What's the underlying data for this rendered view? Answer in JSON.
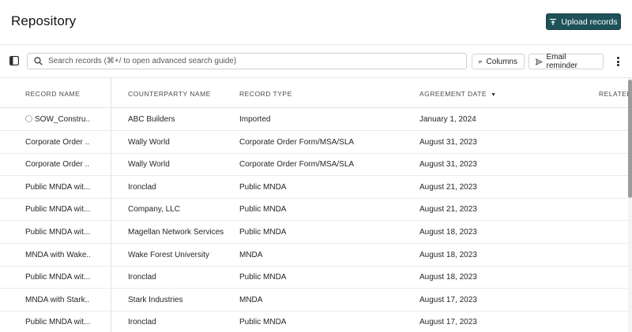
{
  "header": {
    "title": "Repository",
    "upload_label": "Upload records"
  },
  "toolbar": {
    "search_placeholder": "Search records (⌘+/ to open advanced search guide)",
    "columns_label": "Columns",
    "email_label": "Email reminder"
  },
  "table": {
    "columns": [
      "RECORD NAME",
      "COUNTERPARTY NAME",
      "RECORD TYPE",
      "AGREEMENT DATE",
      "RELATED"
    ],
    "sorted_column": "AGREEMENT DATE",
    "rows": [
      {
        "name": "SOW_Constru...",
        "counterparty": "ABC Builders",
        "type": "Imported",
        "date": "January 1, 2024",
        "loading": true
      },
      {
        "name": "Corporate Order ...",
        "counterparty": "Wally World",
        "type": "Corporate Order Form/MSA/SLA",
        "date": "August 31, 2023"
      },
      {
        "name": "Corporate Order ...",
        "counterparty": "Wally World",
        "type": "Corporate Order Form/MSA/SLA",
        "date": "August 31, 2023"
      },
      {
        "name": "Public MNDA wit...",
        "counterparty": "Ironclad",
        "type": "Public MNDA",
        "date": "August 21, 2023"
      },
      {
        "name": "Public MNDA wit...",
        "counterparty": "Company, LLC",
        "type": "Public MNDA",
        "date": "August 21, 2023"
      },
      {
        "name": "Public MNDA wit...",
        "counterparty": "Magellan Network Services",
        "type": "Public MNDA",
        "date": "August 18, 2023"
      },
      {
        "name": "MNDA with Wake...",
        "counterparty": "Wake Forest University",
        "type": "MNDA",
        "date": "August 18, 2023"
      },
      {
        "name": "Public MNDA wit...",
        "counterparty": "Ironclad",
        "type": "Public MNDA",
        "date": "August 18, 2023"
      },
      {
        "name": "MNDA with Stark...",
        "counterparty": "Stark Industries",
        "type": "MNDA",
        "date": "August 17, 2023"
      },
      {
        "name": "Public MNDA wit...",
        "counterparty": "Ironclad",
        "type": "Public MNDA",
        "date": "August 17, 2023"
      }
    ]
  }
}
